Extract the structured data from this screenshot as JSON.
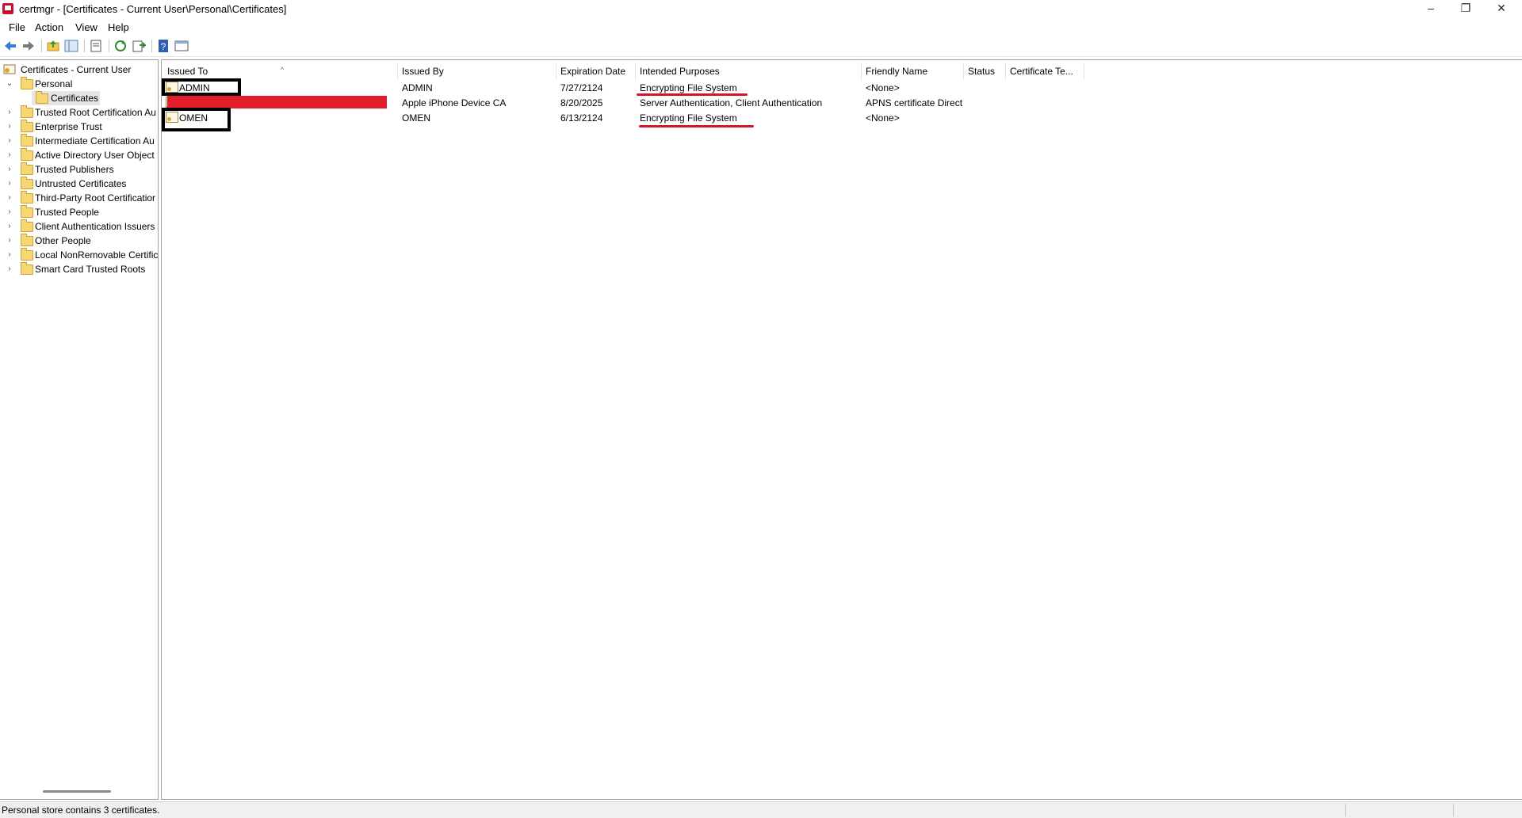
{
  "window": {
    "title": "certmgr - [Certificates - Current User\\Personal\\Certificates]",
    "minimize": "–",
    "restore": "❐",
    "close": "✕"
  },
  "menu": {
    "file": "File",
    "action": "Action",
    "view": "View",
    "help": "Help"
  },
  "toolbar": {
    "icons": [
      "back-arrow-icon",
      "forward-arrow-icon",
      "up-folder-icon",
      "show-hide-tree-icon",
      "properties-icon",
      "refresh-icon",
      "export-list-icon",
      "help-icon",
      "mmc-view-icon"
    ]
  },
  "tree": {
    "root": "Certificates - Current User",
    "personal": "Personal",
    "certificates": "Certificates",
    "stores": [
      "Trusted Root Certification Au",
      "Enterprise Trust",
      "Intermediate Certification Au",
      "Active Directory User Object",
      "Trusted Publishers",
      "Untrusted Certificates",
      "Third-Party Root Certificatior",
      "Trusted People",
      "Client Authentication Issuers",
      "Other People",
      "Local NonRemovable Certific",
      "Smart Card Trusted Roots"
    ]
  },
  "list": {
    "columns": [
      "Issued To",
      "Issued By",
      "Expiration Date",
      "Intended Purposes",
      "Friendly Name",
      "Status",
      "Certificate Te..."
    ],
    "rows": [
      {
        "issued_to": "ADMIN",
        "issued_by": "ADMIN",
        "expiration": "7/27/2124",
        "purposes": "Encrypting File System",
        "friendly": "<None>"
      },
      {
        "issued_to": "",
        "issued_by": "Apple iPhone Device CA",
        "expiration": "8/20/2025",
        "purposes": "Server Authentication, Client Authentication",
        "friendly": "APNS certificate Direct"
      },
      {
        "issued_to": "OMEN",
        "issued_by": "OMEN",
        "expiration": "6/13/2124",
        "purposes": "Encrypting File System",
        "friendly": "<None>"
      }
    ]
  },
  "status": {
    "text": "Personal store contains 3 certificates."
  },
  "colors": {
    "redaction": "#e21d2a",
    "annotation_underline": "#d3162a",
    "annotation_box": "#000000"
  }
}
